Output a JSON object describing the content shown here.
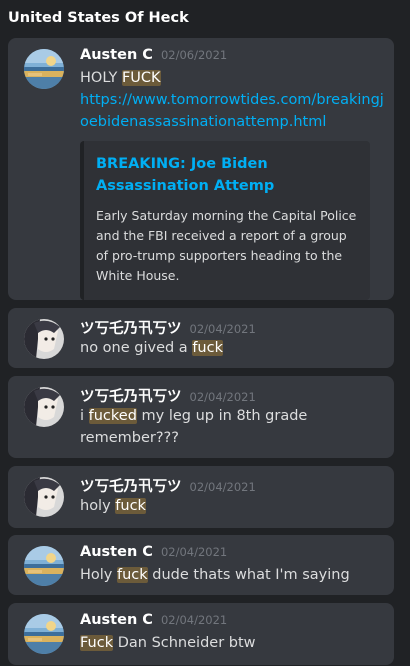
{
  "channel": {
    "title": "United States Of Heck"
  },
  "messages": [
    {
      "author": "Austen C",
      "timestamp": "02/06/2021",
      "avatar": "landscape-avatar",
      "text_parts": [
        {
          "text": "HOLY ",
          "hl": false
        },
        {
          "text": "FUCK",
          "hl": true
        }
      ],
      "link": "https://www.tomorrowtides.com/breakingjoebidenassassinationattemp.html",
      "embed": {
        "title": "BREAKING: Joe Biden Assassination Attemp",
        "description": "Early Saturday morning the Capital Police and the FBI received a report of a group of pro-trump supporters heading to the White House."
      }
    },
    {
      "author": "ツ丂乇乃卂丂ツ",
      "timestamp": "02/04/2021",
      "avatar": "anime-avatar",
      "text_parts": [
        {
          "text": "no one gived a ",
          "hl": false
        },
        {
          "text": "fuck",
          "hl": true
        }
      ]
    },
    {
      "author": "ツ丂乇乃卂丂ツ",
      "timestamp": "02/04/2021",
      "avatar": "anime-avatar",
      "text_parts": [
        {
          "text": "i ",
          "hl": false
        },
        {
          "text": "fucked",
          "hl": true
        },
        {
          "text": " my leg up in 8th grade remember???",
          "hl": false
        }
      ]
    },
    {
      "author": "ツ丂乇乃卂丂ツ",
      "timestamp": "02/04/2021",
      "avatar": "anime-avatar",
      "text_parts": [
        {
          "text": "holy ",
          "hl": false
        },
        {
          "text": "fuck",
          "hl": true
        }
      ]
    },
    {
      "author": "Austen C",
      "timestamp": "02/04/2021",
      "avatar": "landscape-avatar",
      "text_parts": [
        {
          "text": "Holy ",
          "hl": false
        },
        {
          "text": "fuck",
          "hl": true
        },
        {
          "text": " dude thats what I'm saying",
          "hl": false
        }
      ]
    },
    {
      "author": "Austen C",
      "timestamp": "02/04/2021",
      "avatar": "landscape-avatar",
      "text_parts": [
        {
          "text": "Fuck",
          "hl": true
        },
        {
          "text": " Dan Schneider btw",
          "hl": false
        }
      ]
    }
  ],
  "colors": {
    "background": "#202225",
    "card": "#36393f",
    "embed": "#2f3136",
    "link": "#00aff4",
    "highlight": "#6c5b3a",
    "timestamp": "#72767d"
  }
}
